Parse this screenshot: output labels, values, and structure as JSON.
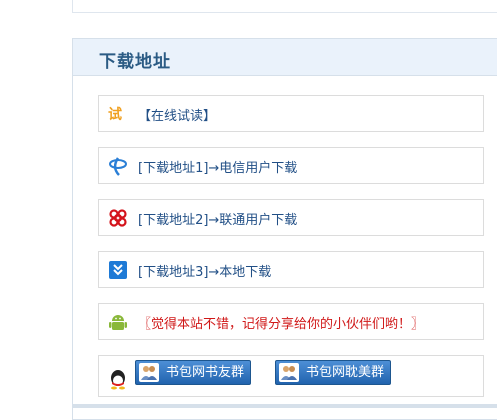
{
  "panel": {
    "title": "下载地址"
  },
  "rows": [
    {
      "icon": "trial-read-icon",
      "label": "【在线试读】",
      "color": "#214f86"
    },
    {
      "icon": "telecom-icon",
      "label": "[下载地址1]→电信用户下载",
      "color": "#214f86"
    },
    {
      "icon": "unicom-icon",
      "label": "[下载地址2]→联通用户下载",
      "color": "#214f86"
    },
    {
      "icon": "local-download-icon",
      "label": "[下载地址3]→本地下载",
      "color": "#214f86"
    },
    {
      "icon": "android-icon",
      "label": "〖觉得本站不错，记得分享给你的小伙伴们哟！〗",
      "color": "#d01818"
    }
  ],
  "qq_group": {
    "icon": "qq-icon",
    "buttons": [
      {
        "label": "书包网书友群"
      },
      {
        "label": "书包网耽美群"
      }
    ]
  },
  "colors": {
    "header_bg": "#eaf2fb",
    "title": "#2b5b84",
    "link": "#214f86",
    "accent_red": "#d01818"
  }
}
